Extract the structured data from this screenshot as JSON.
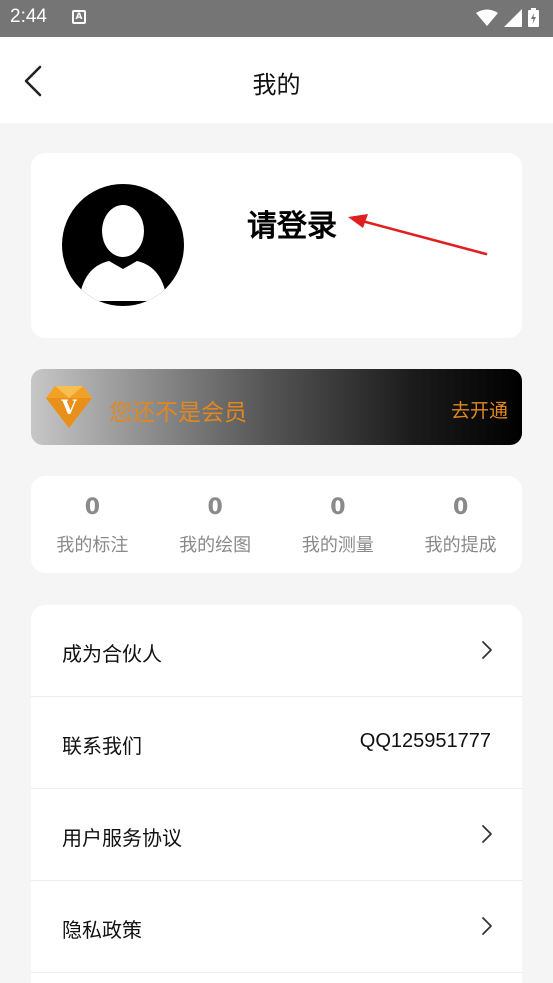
{
  "status_bar": {
    "time": "2:44",
    "app_icon_letter": "A"
  },
  "header": {
    "title": "我的"
  },
  "profile": {
    "login_text": "请登录"
  },
  "vip": {
    "badge_letter": "V",
    "message": "您还不是会员",
    "action": "去开通",
    "accent_color": "#e2871f"
  },
  "stats": [
    {
      "value": "0",
      "label": "我的标注"
    },
    {
      "value": "0",
      "label": "我的绘图"
    },
    {
      "value": "0",
      "label": "我的测量"
    },
    {
      "value": "0",
      "label": "我的提成"
    }
  ],
  "menu": [
    {
      "label": "成为合伙人"
    },
    {
      "label": "联系我们",
      "value": "QQ125951777"
    },
    {
      "label": "用户服务协议"
    },
    {
      "label": "隐私政策"
    }
  ],
  "icons": {
    "back": "back-icon",
    "avatar": "avatar-icon",
    "diamond": "diamond-icon",
    "chevron": "chevron-right-icon",
    "wifi": "wifi-icon",
    "signal": "signal-icon",
    "battery": "battery-icon"
  }
}
